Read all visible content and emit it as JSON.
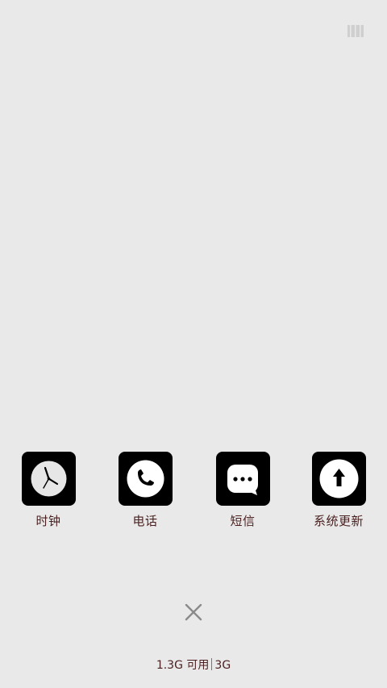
{
  "top_bar": {
    "icon": "recent-apps-grid-icon"
  },
  "apps": [
    {
      "label": "时钟",
      "icon": "clock-icon"
    },
    {
      "label": "电话",
      "icon": "phone-icon"
    },
    {
      "label": "短信",
      "icon": "message-icon"
    },
    {
      "label": "系统更新",
      "icon": "system-update-icon"
    }
  ],
  "close_icon": "close-icon",
  "memory": {
    "available": "1.3G 可用",
    "total": "3G"
  },
  "colors": {
    "background": "#e9e9e9",
    "tile": "#000000",
    "label_text": "#4a1f1f",
    "icon_gray": "#c8c8c8"
  }
}
